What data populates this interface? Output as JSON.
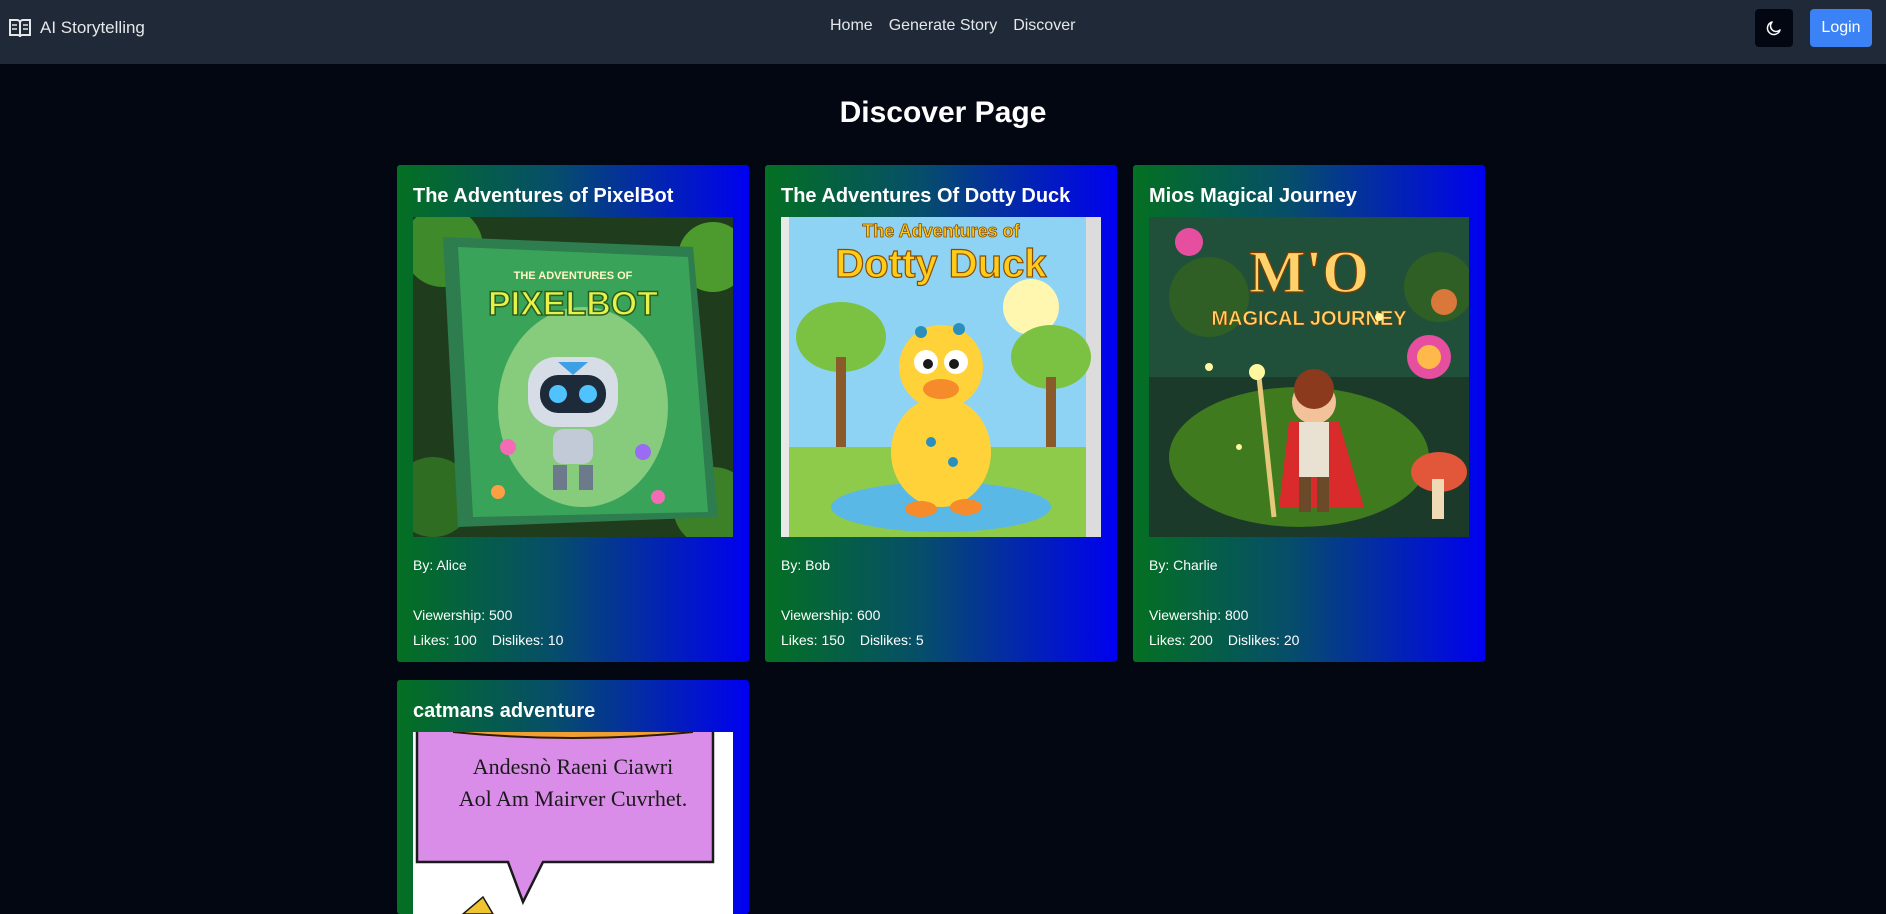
{
  "app": {
    "brand": "AI Storytelling"
  },
  "nav": {
    "links": [
      "Home",
      "Generate Story",
      "Discover"
    ]
  },
  "header": {
    "theme_icon": "moon-icon",
    "login_label": "Login"
  },
  "page": {
    "title": "Discover Page"
  },
  "labels": {
    "by": "By: ",
    "viewership": "Viewership: ",
    "likes": "Likes: ",
    "dislikes": "Dislikes: "
  },
  "stories": [
    {
      "title": "The Adventures of PixelBot",
      "author": "Alice",
      "viewership": 500,
      "likes": 100,
      "dislikes": 10,
      "cover": {
        "title_small": "THE ADVENTURES OF",
        "title_big": "PIXELBOT"
      }
    },
    {
      "title": "The Adventures Of Dotty Duck",
      "author": "Bob",
      "viewership": 600,
      "likes": 150,
      "dislikes": 5,
      "cover": {
        "title_small": "The Adventures of",
        "title_big": "Dotty Duck"
      }
    },
    {
      "title": "Mios Magical Journey",
      "author": "Charlie",
      "viewership": 800,
      "likes": 200,
      "dislikes": 20,
      "cover": {
        "title_small": "M'O",
        "title_big": "MAGICAL JOURNEY"
      }
    },
    {
      "title": "catmans adventure",
      "cover": {
        "title_small": "Andesnò Raeni Ciawri",
        "title_big": "Aol Am Mairver Cuvrhet."
      }
    }
  ]
}
